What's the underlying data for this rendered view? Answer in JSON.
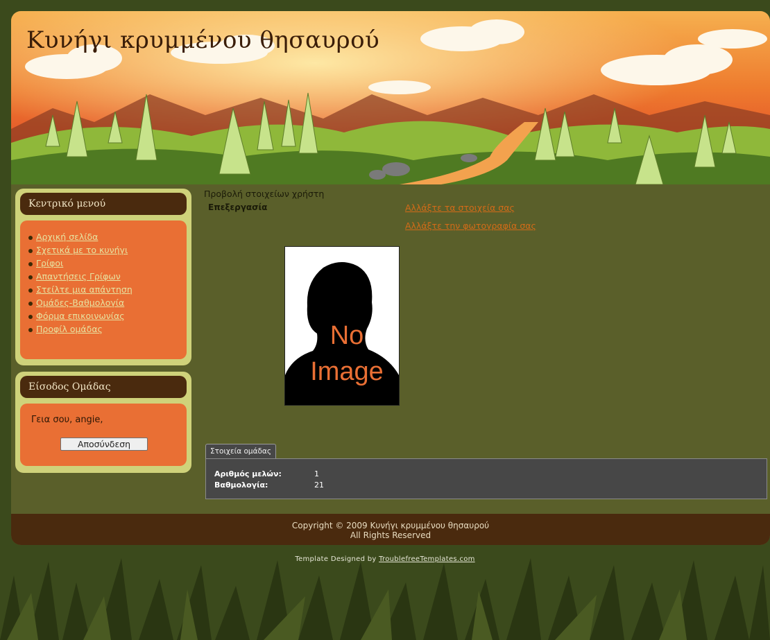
{
  "site": {
    "title": "Κυνήγι κρυμμένου θησαυρού"
  },
  "sidebar": {
    "menu_title": "Κεντρικό μενού",
    "menu_items": [
      {
        "label": "Αρχική σελίδα"
      },
      {
        "label": "Σχετικά με το κυνήγι"
      },
      {
        "label": "Γρίφοι"
      },
      {
        "label": "Απαντήσεις Γρίφων"
      },
      {
        "label": "Στείλτε μια απάντηση"
      },
      {
        "label": "Ομάδες-Βαθμολογία"
      },
      {
        "label": "Φόρμα επικοινωνίας"
      },
      {
        "label": "Προφίλ ομάδας"
      }
    ],
    "login_title": "Είσοδος Ομάδας",
    "greeting": "Γεια σου, angie,",
    "logout_label": "Αποσύνδεση"
  },
  "main": {
    "view_label": "Προβολή στοιχείων χρήστη",
    "edit_label": "Επεξεργασία",
    "link_change_details": "Αλλάξτε τα στοιχεία σας",
    "link_change_photo": "Αλλάξτε την φωτογραφία σας",
    "photo_text_1": "No",
    "photo_text_2": "Image",
    "tab_label": "Στοιχεία ομάδας",
    "stats": [
      {
        "label": "Αριθμός μελών:",
        "value": "1"
      },
      {
        "label": "Βαθμολογία:",
        "value": "21"
      }
    ]
  },
  "footer": {
    "copyright": "Copyright © 2009 Κυνήγι κρυμμένου θησαυρού",
    "rights": "All Rights Reserved",
    "credit_prefix": "Template Designed by",
    "credit_link": "TroublefreeTemplates.com"
  },
  "colors": {
    "page_bg": "#3b4a1c",
    "content_bg": "#5a5f2a",
    "sidebar_frame": "#cfd27a",
    "sidebar_title_bg": "#4a2a0e",
    "sidebar_body_bg": "#e96f34",
    "link_orange": "#d36b18",
    "footer_bg": "#4a2a0e"
  }
}
